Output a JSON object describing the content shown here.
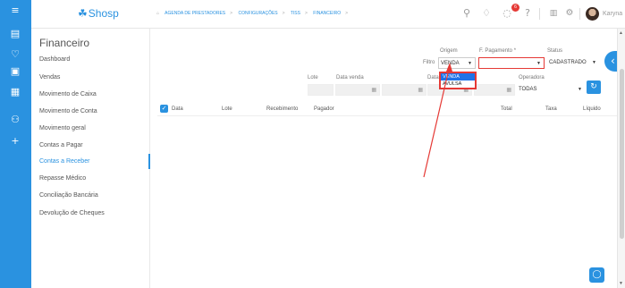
{
  "app": {
    "logo_text": "Shosp",
    "logo_icon": "shosp-logo-icon"
  },
  "rail": {
    "icons": [
      "menu-icon",
      "calendar-icon",
      "heart-icon",
      "money-icon",
      "reports-icon",
      "users-icon",
      "plus-icon"
    ]
  },
  "breadcrumb": {
    "items": [
      "AGENDA DE PRESTADORES",
      "CONFIGURAÇÕES",
      "TISS",
      "FINANCEIRO"
    ],
    "sep": ">"
  },
  "topbar": {
    "notification_count": "6",
    "username": "Karyna"
  },
  "sidemenu": {
    "title": "Financeiro",
    "items": [
      "Dashboard",
      "Vendas",
      "Movimento de Caixa",
      "Movimento de Conta",
      "Movimento geral",
      "Contas a Pagar",
      "Contas a Receber",
      "Repasse Médico",
      "Conciliação Bancária",
      "Devolução de Cheques"
    ],
    "active": "Contas a Receber"
  },
  "filters": {
    "origem_label": "Origem",
    "filtro_label": "Filtro",
    "origem_value": "VENDA",
    "origem_options": [
      "VENDA",
      "AVULSA"
    ],
    "f_pagamento_label": "F. Pagamento *",
    "f_pagamento_value": "",
    "status_label": "Status",
    "status_value": "CADASTRADO",
    "lote_label": "Lote",
    "data_venda_label": "Data venda",
    "data_label": "Data",
    "operadora_label": "Operadora",
    "operadora_value": "TODAS"
  },
  "table": {
    "columns": [
      "Data",
      "Lote",
      "Recebimento",
      "Pagador",
      "Total",
      "Taxa",
      "Líquido"
    ]
  },
  "colors": {
    "accent": "#2a92e0",
    "highlight": "#e53935"
  }
}
